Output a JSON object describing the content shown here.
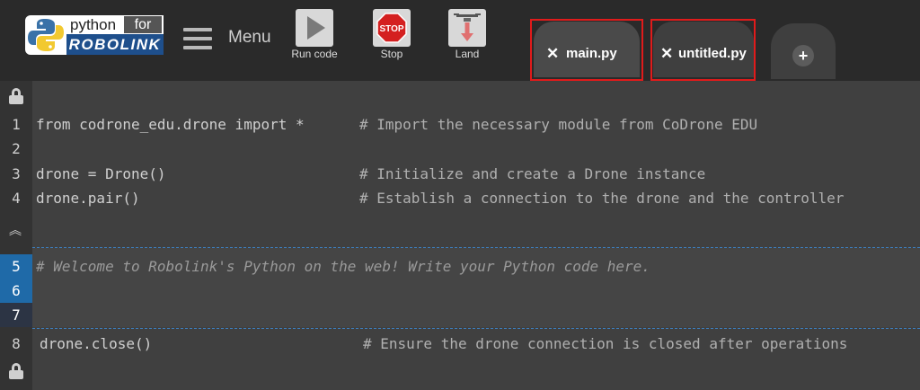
{
  "logo": {
    "top": "python",
    "for": "for",
    "bottom": "ROBOLINK"
  },
  "menu": {
    "label": "Menu"
  },
  "toolbar": {
    "run_label": "Run code",
    "stop_label": "Stop",
    "stop_sign": "STOP",
    "land_label": "Land"
  },
  "tabs": [
    {
      "close": "✕",
      "name": "main.py"
    },
    {
      "close": "✕",
      "name": "untitled.py"
    }
  ],
  "add_tab": "+",
  "editor": {
    "lines": [
      {
        "num": "1",
        "code": "from codrone_edu.drone import *",
        "comment": "# Import the necessary module from CoDrone EDU"
      },
      {
        "num": "2",
        "code": "",
        "comment": ""
      },
      {
        "num": "3",
        "code": "drone = Drone()",
        "comment": "# Initialize and create a Drone instance"
      },
      {
        "num": "4",
        "code": "drone.pair()",
        "comment": "# Establish a connection to the drone and the controller"
      },
      {
        "num": "5",
        "code": "# Welcome to Robolink's Python on the web! Write your Python code here.",
        "comment": ""
      },
      {
        "num": "6",
        "code": "",
        "comment": ""
      },
      {
        "num": "7",
        "code": "",
        "comment": ""
      },
      {
        "num": "8",
        "code": "drone.close()",
        "comment": "# Ensure the drone connection is closed after operations"
      }
    ]
  },
  "colors": {
    "accent": "#1f6aa8",
    "highlight": "#e01b1b",
    "stop": "#d42020",
    "brand": "#1e4f8c"
  }
}
